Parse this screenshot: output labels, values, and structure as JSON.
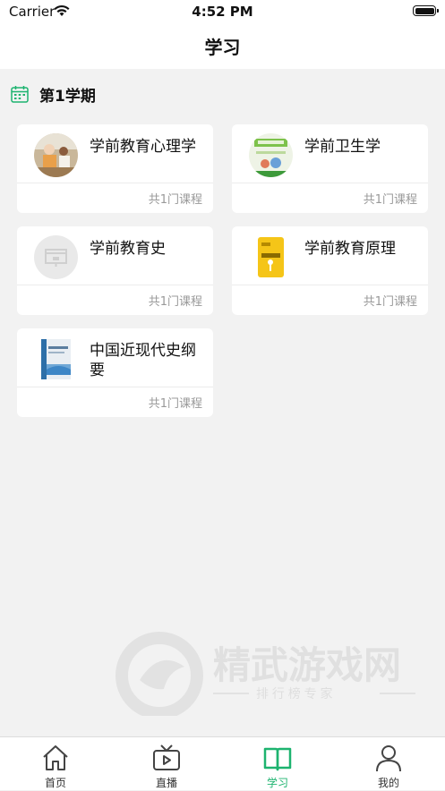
{
  "status_bar": {
    "carrier": "Carrier",
    "time": "4:52 PM"
  },
  "nav": {
    "title": "学习"
  },
  "semester": {
    "title": "第1学期",
    "icon": "calendar-icon"
  },
  "courses": [
    {
      "name": "学前教育心理学",
      "count": "共1门课程"
    },
    {
      "name": "学前卫生学",
      "count": "共1门课程"
    },
    {
      "name": "学前教育史",
      "count": "共1门课程"
    },
    {
      "name": "学前教育原理",
      "count": "共1门课程"
    },
    {
      "name": "中国近现代史纲要",
      "count": "共1门课程"
    }
  ],
  "watermark": {
    "brand": "精武游戏网",
    "tagline": "排 行 榜 专 家"
  },
  "tabs": [
    {
      "label": "首页",
      "icon": "home-icon"
    },
    {
      "label": "直播",
      "icon": "tv-icon"
    },
    {
      "label": "学习",
      "icon": "book-icon",
      "active": true
    },
    {
      "label": "我的",
      "icon": "person-icon"
    }
  ],
  "colors": {
    "accent": "#1db36f",
    "background": "#f2f2f2"
  }
}
